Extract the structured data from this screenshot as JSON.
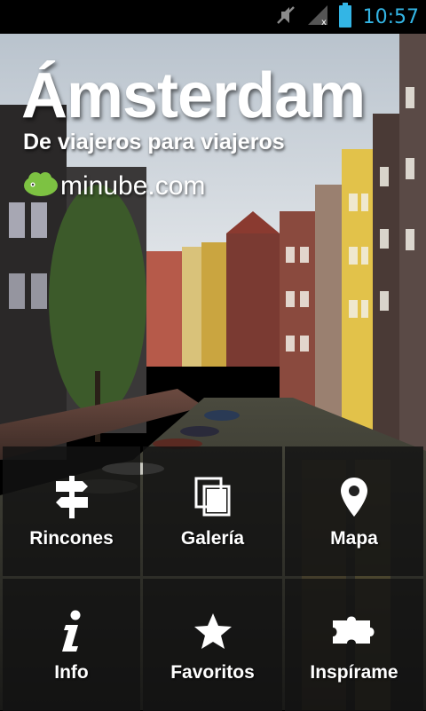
{
  "status_bar": {
    "time": "10:57",
    "icons": [
      "mute-icon",
      "signal-icon",
      "battery-icon"
    ],
    "accent_color": "#33b5e5"
  },
  "header": {
    "title": "Ámsterdam",
    "subtitle": "De viajeros para viajeros",
    "brand": "minube.com",
    "brand_color": "#7dc242"
  },
  "menu": {
    "tiles": [
      {
        "label": "Rincones",
        "icon": "signpost-icon"
      },
      {
        "label": "Galería",
        "icon": "gallery-icon"
      },
      {
        "label": "Mapa",
        "icon": "map-pin-icon"
      },
      {
        "label": "Info",
        "icon": "info-icon"
      },
      {
        "label": "Favoritos",
        "icon": "star-icon"
      },
      {
        "label": "Inspírame",
        "icon": "puzzle-icon"
      }
    ]
  }
}
